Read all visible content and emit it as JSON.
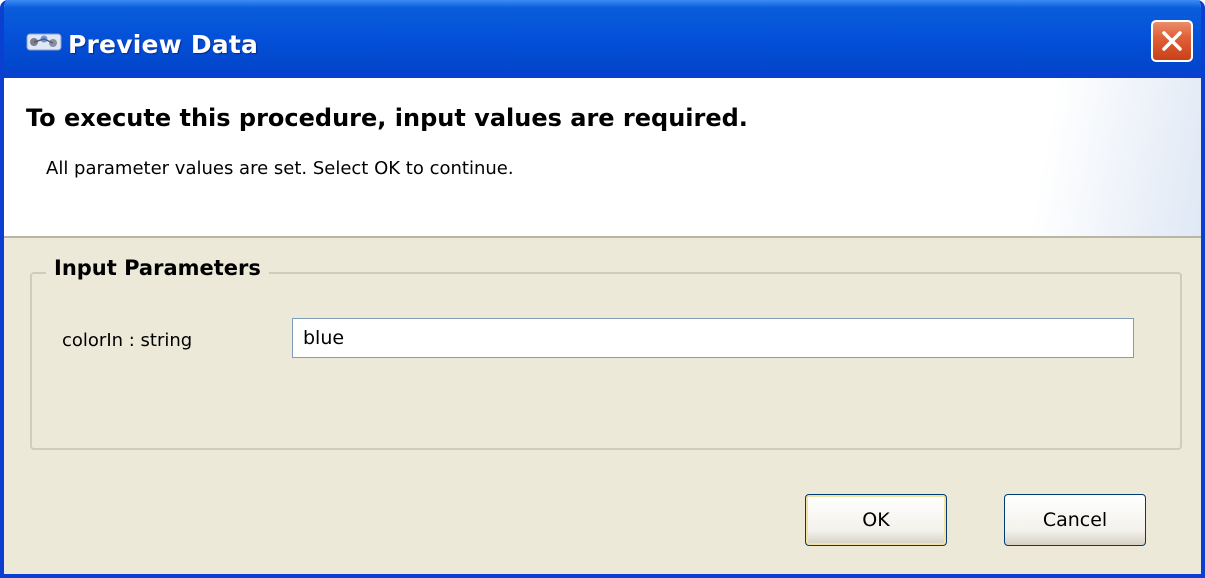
{
  "window": {
    "title": "Preview Data",
    "icon": "data-preview-icon",
    "close_icon": "close-icon"
  },
  "header": {
    "title": "To execute this procedure, input values are required.",
    "message": "All parameter values are set. Select OK to continue."
  },
  "input_parameters": {
    "legend": "Input Parameters",
    "params": [
      {
        "label": "colorIn : string",
        "value": "blue"
      }
    ]
  },
  "buttons": {
    "ok_label": "OK",
    "cancel_label": "Cancel"
  },
  "colors": {
    "titlebar": "#0450d8",
    "close_button": "#e16137",
    "dialog_background": "#ece9d8"
  }
}
